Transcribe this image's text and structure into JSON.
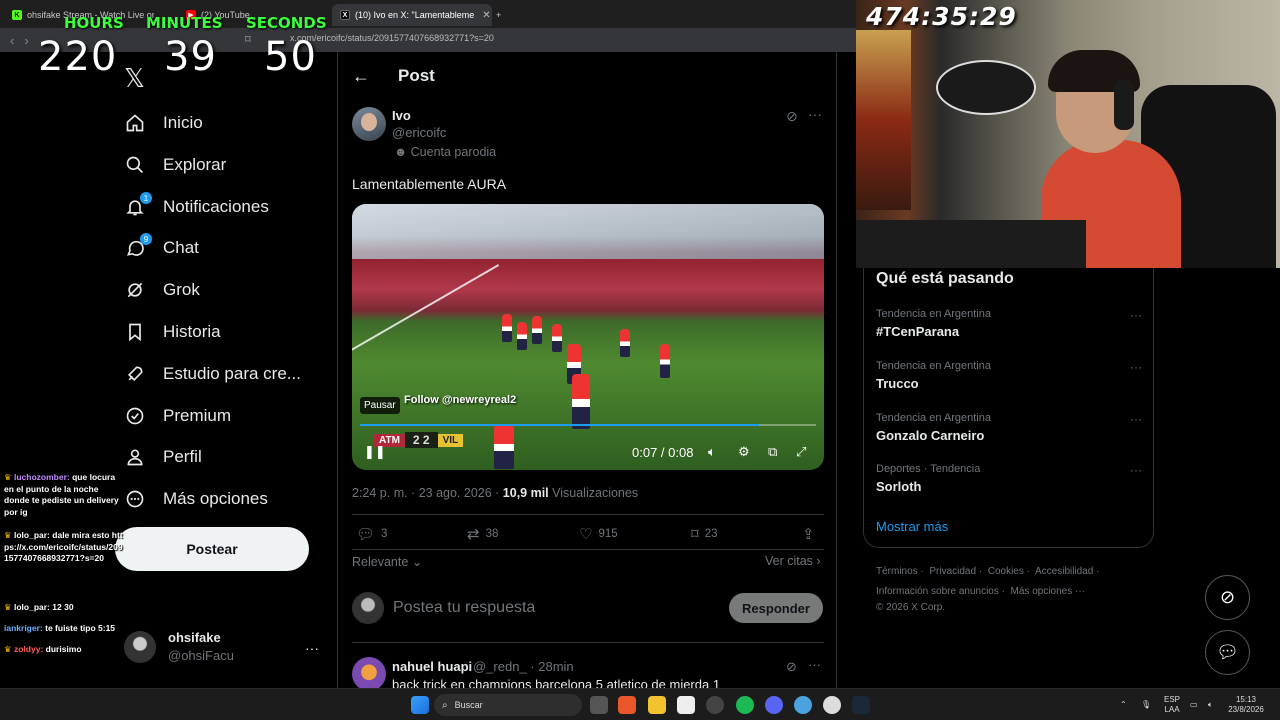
{
  "browser": {
    "tabs": [
      {
        "title": "ohsifake Stream - Watch Live on"
      },
      {
        "title": "(2) YouTube"
      },
      {
        "title": "(10) Ivo en X: \"Lamentableme"
      }
    ],
    "url": "x.com/ericoifc/status/2091577407668932771?s=20"
  },
  "stream_timer": {
    "hours_label": "HOURS",
    "minutes_label": "MINUTES",
    "seconds_label": "SECONDS",
    "hours": "220",
    "minutes": "39",
    "seconds": "50",
    "elapsed": "474:35:29"
  },
  "nav": {
    "items": [
      {
        "label": "Inicio",
        "icon": "home-icon"
      },
      {
        "label": "Explorar",
        "icon": "search-icon"
      },
      {
        "label": "Notificaciones",
        "icon": "bell-icon",
        "badge": "1"
      },
      {
        "label": "Chat",
        "icon": "chat-icon",
        "badge": "9"
      },
      {
        "label": "Grok",
        "icon": "grok-icon"
      },
      {
        "label": "Historia",
        "icon": "bookmark-icon"
      },
      {
        "label": "Estudio para cre...",
        "icon": "rocket-icon"
      },
      {
        "label": "Premium",
        "icon": "verified-icon"
      },
      {
        "label": "Perfil",
        "icon": "person-icon"
      },
      {
        "label": "Más opciones",
        "icon": "more-circle-icon"
      }
    ],
    "post_button": "Postear",
    "account": {
      "name": "ohsifake",
      "handle": "@ohsiFacu"
    }
  },
  "chat": [
    {
      "user": "luchozomber:",
      "text": "que locura en el punto de la noche donde te pediste un delivery por ig"
    },
    {
      "user": "lolo_par:",
      "text": "dale mira esto https://x.com/ericoifc/status/2091577407668932771?s=20"
    },
    {
      "user": "lolo_par:",
      "text": "12 30"
    },
    {
      "user": "iankriger:",
      "text": "te fuiste tipo 5:15"
    },
    {
      "user": "zoldyy:",
      "text": "durisimo"
    }
  ],
  "post": {
    "header": "Post",
    "author": {
      "name": "Ivo",
      "handle": "@ericoifc",
      "label": "Cuenta parodia"
    },
    "text": "Lamentablemente AURA",
    "video": {
      "tooltip": "Pausar",
      "overlay_text": "Follow @newreyreal2",
      "time": "0:07 / 0:08",
      "progress": 0.875,
      "team1": "ATM",
      "score": "2 2",
      "team2": "VIL"
    },
    "timestamp": "2:24 p. m. · 23 ago. 2026 · ",
    "views_count": "10,9 mil",
    "views_label": " Visualizaciones",
    "stats": {
      "replies": "3",
      "reposts": "38",
      "likes": "915",
      "bookmarks": "23"
    },
    "sort_label": "Relevante",
    "quotes_label": "Ver citas",
    "reply_placeholder": "Postea tu respuesta",
    "reply_button": "Responder"
  },
  "comment": {
    "name": "nahuel huapi",
    "handle": "@_redn_ · 28min",
    "text": "back trick en champions barcelona 5 atletico de mierda 1"
  },
  "trends": {
    "heading": "Qué está pasando",
    "items": [
      {
        "context": "Tendencia en Argentina",
        "name": "#TCenParana"
      },
      {
        "context": "Tendencia en Argentina",
        "name": "Trucco"
      },
      {
        "context": "Tendencia en Argentina",
        "name": "Gonzalo Carneiro"
      },
      {
        "context": "Deportes · Tendencia",
        "name": "Sorloth"
      }
    ],
    "show_more": "Mostrar más"
  },
  "footer": {
    "line1": [
      "Términos",
      "Privacidad",
      "Cookies",
      "Accesibilidad"
    ],
    "line2": [
      "Información sobre anuncios",
      "Más opciones ···"
    ],
    "copyright": "© 2026 X Corp."
  },
  "taskbar": {
    "search_placeholder": "Buscar",
    "lang": "ESP",
    "lang2": "LAA",
    "time": "15:13",
    "date": "23/8/2026"
  },
  "colors": {
    "accent": "#1d9bf0",
    "timer_green": "#3cff3c"
  }
}
